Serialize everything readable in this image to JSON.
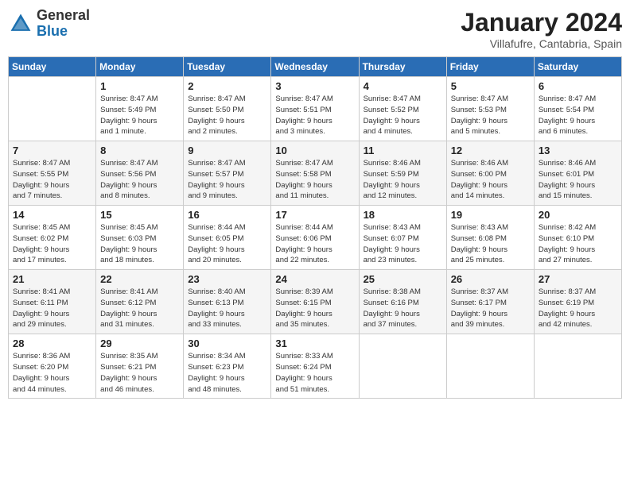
{
  "header": {
    "logo_general": "General",
    "logo_blue": "Blue",
    "month": "January 2024",
    "location": "Villafufre, Cantabria, Spain"
  },
  "days_of_week": [
    "Sunday",
    "Monday",
    "Tuesday",
    "Wednesday",
    "Thursday",
    "Friday",
    "Saturday"
  ],
  "weeks": [
    [
      {
        "num": "",
        "detail": ""
      },
      {
        "num": "1",
        "detail": "Sunrise: 8:47 AM\nSunset: 5:49 PM\nDaylight: 9 hours\nand 1 minute."
      },
      {
        "num": "2",
        "detail": "Sunrise: 8:47 AM\nSunset: 5:50 PM\nDaylight: 9 hours\nand 2 minutes."
      },
      {
        "num": "3",
        "detail": "Sunrise: 8:47 AM\nSunset: 5:51 PM\nDaylight: 9 hours\nand 3 minutes."
      },
      {
        "num": "4",
        "detail": "Sunrise: 8:47 AM\nSunset: 5:52 PM\nDaylight: 9 hours\nand 4 minutes."
      },
      {
        "num": "5",
        "detail": "Sunrise: 8:47 AM\nSunset: 5:53 PM\nDaylight: 9 hours\nand 5 minutes."
      },
      {
        "num": "6",
        "detail": "Sunrise: 8:47 AM\nSunset: 5:54 PM\nDaylight: 9 hours\nand 6 minutes."
      }
    ],
    [
      {
        "num": "7",
        "detail": "Sunrise: 8:47 AM\nSunset: 5:55 PM\nDaylight: 9 hours\nand 7 minutes."
      },
      {
        "num": "8",
        "detail": "Sunrise: 8:47 AM\nSunset: 5:56 PM\nDaylight: 9 hours\nand 8 minutes."
      },
      {
        "num": "9",
        "detail": "Sunrise: 8:47 AM\nSunset: 5:57 PM\nDaylight: 9 hours\nand 9 minutes."
      },
      {
        "num": "10",
        "detail": "Sunrise: 8:47 AM\nSunset: 5:58 PM\nDaylight: 9 hours\nand 11 minutes."
      },
      {
        "num": "11",
        "detail": "Sunrise: 8:46 AM\nSunset: 5:59 PM\nDaylight: 9 hours\nand 12 minutes."
      },
      {
        "num": "12",
        "detail": "Sunrise: 8:46 AM\nSunset: 6:00 PM\nDaylight: 9 hours\nand 14 minutes."
      },
      {
        "num": "13",
        "detail": "Sunrise: 8:46 AM\nSunset: 6:01 PM\nDaylight: 9 hours\nand 15 minutes."
      }
    ],
    [
      {
        "num": "14",
        "detail": "Sunrise: 8:45 AM\nSunset: 6:02 PM\nDaylight: 9 hours\nand 17 minutes."
      },
      {
        "num": "15",
        "detail": "Sunrise: 8:45 AM\nSunset: 6:03 PM\nDaylight: 9 hours\nand 18 minutes."
      },
      {
        "num": "16",
        "detail": "Sunrise: 8:44 AM\nSunset: 6:05 PM\nDaylight: 9 hours\nand 20 minutes."
      },
      {
        "num": "17",
        "detail": "Sunrise: 8:44 AM\nSunset: 6:06 PM\nDaylight: 9 hours\nand 22 minutes."
      },
      {
        "num": "18",
        "detail": "Sunrise: 8:43 AM\nSunset: 6:07 PM\nDaylight: 9 hours\nand 23 minutes."
      },
      {
        "num": "19",
        "detail": "Sunrise: 8:43 AM\nSunset: 6:08 PM\nDaylight: 9 hours\nand 25 minutes."
      },
      {
        "num": "20",
        "detail": "Sunrise: 8:42 AM\nSunset: 6:10 PM\nDaylight: 9 hours\nand 27 minutes."
      }
    ],
    [
      {
        "num": "21",
        "detail": "Sunrise: 8:41 AM\nSunset: 6:11 PM\nDaylight: 9 hours\nand 29 minutes."
      },
      {
        "num": "22",
        "detail": "Sunrise: 8:41 AM\nSunset: 6:12 PM\nDaylight: 9 hours\nand 31 minutes."
      },
      {
        "num": "23",
        "detail": "Sunrise: 8:40 AM\nSunset: 6:13 PM\nDaylight: 9 hours\nand 33 minutes."
      },
      {
        "num": "24",
        "detail": "Sunrise: 8:39 AM\nSunset: 6:15 PM\nDaylight: 9 hours\nand 35 minutes."
      },
      {
        "num": "25",
        "detail": "Sunrise: 8:38 AM\nSunset: 6:16 PM\nDaylight: 9 hours\nand 37 minutes."
      },
      {
        "num": "26",
        "detail": "Sunrise: 8:37 AM\nSunset: 6:17 PM\nDaylight: 9 hours\nand 39 minutes."
      },
      {
        "num": "27",
        "detail": "Sunrise: 8:37 AM\nSunset: 6:19 PM\nDaylight: 9 hours\nand 42 minutes."
      }
    ],
    [
      {
        "num": "28",
        "detail": "Sunrise: 8:36 AM\nSunset: 6:20 PM\nDaylight: 9 hours\nand 44 minutes."
      },
      {
        "num": "29",
        "detail": "Sunrise: 8:35 AM\nSunset: 6:21 PM\nDaylight: 9 hours\nand 46 minutes."
      },
      {
        "num": "30",
        "detail": "Sunrise: 8:34 AM\nSunset: 6:23 PM\nDaylight: 9 hours\nand 48 minutes."
      },
      {
        "num": "31",
        "detail": "Sunrise: 8:33 AM\nSunset: 6:24 PM\nDaylight: 9 hours\nand 51 minutes."
      },
      {
        "num": "",
        "detail": ""
      },
      {
        "num": "",
        "detail": ""
      },
      {
        "num": "",
        "detail": ""
      }
    ]
  ]
}
